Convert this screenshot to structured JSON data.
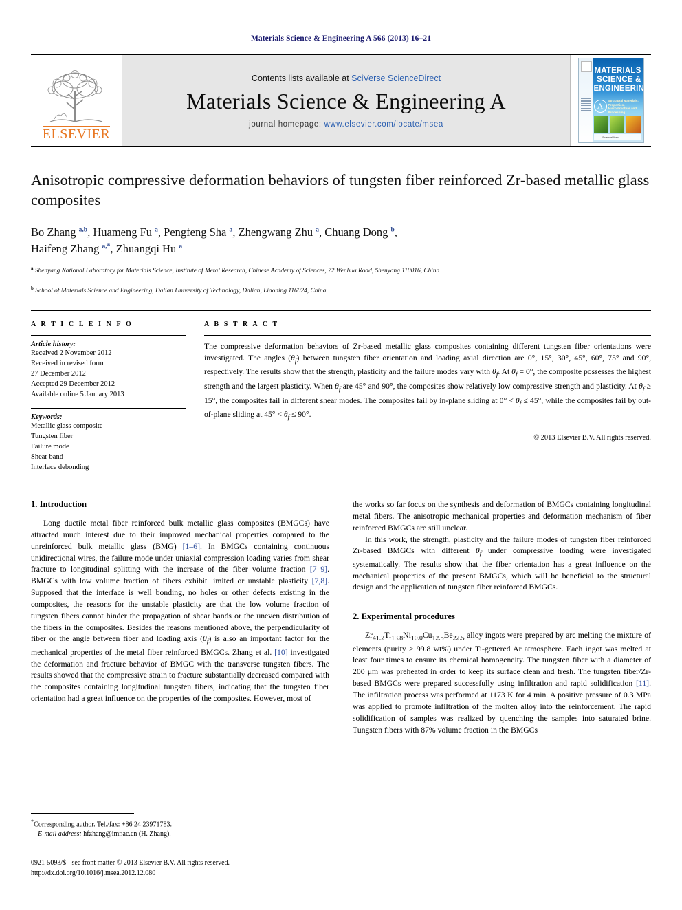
{
  "running_head": "Materials Science & Engineering A 566 (2013) 16–21",
  "masthead": {
    "publisher_logo_text": "ELSEVIER",
    "contents_prefix": "Contents lists available at ",
    "contents_link": "SciVerse ScienceDirect",
    "journal_title": "Materials Science & Engineering A",
    "homepage_prefix": "journal homepage: ",
    "homepage_url": "www.elsevier.com/locate/msea",
    "cover": {
      "line1": "MATERIALS",
      "line2": "SCIENCE &",
      "line3": "ENGINEERING",
      "badge": "A",
      "subtitle": "Structural Materials: Properties, Microstructure and Processing",
      "footer_text": "ScienceDirect"
    }
  },
  "article": {
    "title": "Anisotropic compressive deformation behaviors of tungsten fiber reinforced Zr-based metallic glass composites",
    "authors_html": "Bo Zhang <sup>a,b</sup>, Huameng Fu <sup>a</sup>, Pengfeng Sha <sup>a</sup>, Zhengwang Zhu <sup>a</sup>, Chuang Dong <sup>b</sup>,<br>Haifeng Zhang <sup>a,*</sup>, Zhuangqi Hu <sup>a</sup>",
    "affiliation_a": "Shenyang National Laboratory for Materials Science, Institute of Metal Research, Chinese Academy of Sciences, 72 Wenhua Road, Shenyang 110016, China",
    "affiliation_b": "School of Materials Science and Engineering, Dalian University of Technology, Dalian, Liaoning 116024, China"
  },
  "article_info": {
    "heading": "A R T I C L E   I N F O",
    "history_label": "Article history:",
    "history": [
      "Received 2 November 2012",
      "Received in revised form",
      "27 December 2012",
      "Accepted 29 December 2012",
      "Available online 5 January 2013"
    ],
    "keywords_label": "Keywords:",
    "keywords": [
      "Metallic glass composite",
      "Tungsten fiber",
      "Failure mode",
      "Shear band",
      "Interface debonding"
    ]
  },
  "abstract": {
    "heading": "A B S T R A C T",
    "body_html": "The compressive deformation behaviors of Zr-based metallic glass composites containing different tungsten fiber orientations were investigated. The angles (<i class=\"th\">θ<sub>f</sub></i>) between tungsten fiber orientation and loading axial direction are 0°, 15°, 30°, 45°, 60°, 75° and 90°, respectively. The results show that the strength, plasticity and the failure modes vary with <i class=\"th\">θ<sub>f</sub></i>. At <i class=\"th\">θ<sub>f</sub></i> = 0°, the composite possesses the highest strength and the largest plasticity. When <i class=\"th\">θ<sub>f</sub></i> are 45° and 90°, the composites show relatively low compressive strength and plasticity. At <i class=\"th\">θ<sub>f</sub></i> ≥ 15°, the composites fail in different shear modes. The composites fail by in-plane sliding at 0° &lt; <i class=\"th\">θ<sub>f</sub></i> ≤ 45°, while the composites fail by out-of-plane sliding at 45° &lt; <i class=\"th\">θ<sub>f</sub></i> ≤ 90°.",
    "copyright": "© 2013 Elsevier B.V. All rights reserved."
  },
  "sections": {
    "introduction_heading": "1.  Introduction",
    "experimental_heading": "2.  Experimental procedures",
    "intro_p1_html": "Long ductile metal fiber reinforced bulk metallic glass composites (BMGCs) have attracted much interest due to their improved mechanical properties compared to the unreinforced bulk metallic glass (BMG) <span class=\"ref\">[1–6]</span>. In BMGCs containing continuous unidirectional wires, the failure mode under uniaxial compression loading varies from shear fracture to longitudinal splitting with the increase of the fiber volume fraction <span class=\"ref\">[7–9]</span>. BMGCs with low volume fraction of fibers exhibit limited or unstable plasticity <span class=\"ref\">[7,8]</span>. Supposed that the interface is well bonding, no holes or other defects existing in the composites, the reasons for the unstable plasticity are that the low volume fraction of tungsten fibers cannot hinder the propagation of shear bands or the uneven distribution of the fibers in the composites. Besides the reasons mentioned above, the perpendicularity of fiber or the angle between fiber and loading axis (<i class=\"th\">θ<sub>f</sub></i>) is also an important factor for the mechanical properties of the metal fiber reinforced BMGCs. Zhang et al. <span class=\"ref\">[10]</span> investigated the deformation and fracture behavior of BMGC with the transverse tungsten fibers. The results showed that the compressive strain to fracture substantially decreased compared with the composites containing longitudinal tungsten fibers, indicating that the tungsten fiber orientation had a great influence on the properties of the composites. However, most of",
    "intro_p2_html": "the works so far focus on the synthesis and deformation of BMGCs containing longitudinal metal fibers. The anisotropic mechanical properties and deformation mechanism of fiber reinforced BMGCs are still unclear.",
    "intro_p3_html": "In this work, the strength, plasticity and the failure modes of tungsten fiber reinforced Zr-based BMGCs with different <i class=\"th\">θ<sub>f</sub></i> under compressive loading were investigated systematically. The results show that the fiber orientation has a great influence on the mechanical properties of the present BMGCs, which will be beneficial to the structural design and the application of tungsten fiber reinforced BMGCs.",
    "exp_p1_html": "Zr<sub>41.2</sub>Ti<sub>13.8</sub>Ni<sub>10.0</sub>Cu<sub>12.5</sub>Be<sub>22.5</sub> alloy ingots were prepared by arc melting the mixture of elements (purity &gt; 99.8 wt%) under Ti-gettered Ar atmosphere. Each ingot was melted at least four times to ensure its chemical homogeneity. The tungsten fiber with a diameter of 200 μm was preheated in order to keep its surface clean and fresh. The tungsten fiber/Zr-based BMGCs were prepared successfully using infiltration and rapid solidification <span class=\"ref\">[11]</span>. The infiltration process was performed at 1173 K for 4 min. A positive pressure of 0.3 MPa was applied to promote infiltration of the molten alloy into the reinforcement. The rapid solidification of samples was realized by quenching the samples into saturated brine. Tungsten fibers with 87% volume fraction in the BMGCs"
  },
  "footnote": {
    "corresponding_html": "<sup>*</sup>Corresponding author. Tel./fax: +86 24 23971783.",
    "email_html": "<span class=\"it\">E-mail address:</span> hfzhang@imr.ac.cn (H. Zhang)."
  },
  "footer": {
    "issn_line": "0921-5093/$ - see front matter © 2013 Elsevier B.V. All rights reserved.",
    "doi_line": "http://dx.doi.org/10.1016/j.msea.2012.12.080"
  },
  "colors": {
    "link": "#2b5fb0",
    "reference": "#2b4b9b",
    "running_head": "#1a1a6e",
    "elsevier_orange": "#E87722",
    "band_gray": "#e6e6e6"
  }
}
